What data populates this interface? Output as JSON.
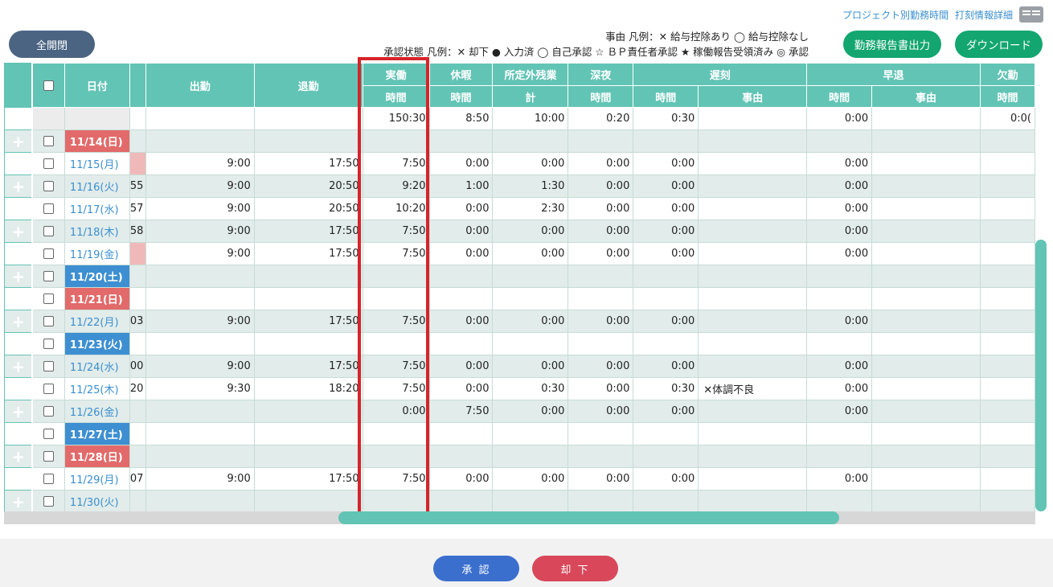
{
  "top_links": {
    "project_hours": "プロジェクト別勤務時間",
    "punch_details": "打刻情報詳細",
    "book_icon": "book-icon"
  },
  "expand_button": "全開閉",
  "legend": {
    "reason": "事由 凡例：✕ 給与控除あり ◯ 給与控除なし",
    "approval": "承認状態 凡例：✕ 却下 ● 入力済 ◯ 自己承認 ☆ ＢＰ責任者承認 ★ 稼働報告受領済み ◎ 承認"
  },
  "buttons": {
    "report_output": "勤務報告書出力",
    "download": "ダウンロード",
    "approve": "承 認",
    "reject": "却 下"
  },
  "header": {
    "date": "日付",
    "clock_in": "出勤",
    "clock_out": "退勤",
    "actual": "実働",
    "actual_sub": "時間",
    "break": "休暇",
    "break_sub": "時間",
    "overtime": "所定外残業",
    "overtime_sub": "計",
    "night": "深夜",
    "night_sub": "時間",
    "late": "遅刻",
    "late_sub_time": "時間",
    "late_sub_reason": "事由",
    "early": "早退",
    "early_sub_time": "時間",
    "early_sub_reason": "事由",
    "absence": "欠勤",
    "absence_sub": "時間"
  },
  "totals": {
    "actual": "150:30",
    "break": "8:50",
    "overtime": "10:00",
    "night": "0:20",
    "late": "0:30",
    "early": "0:00",
    "absence": "0:0("
  },
  "rows": [
    {
      "date": "11/14(日)",
      "kind": "sun",
      "stub": "",
      "in": "",
      "out": "",
      "actual": "",
      "break": "",
      "ot": "",
      "night": "",
      "late": "",
      "reason": "",
      "early": ""
    },
    {
      "date": "11/15(月)",
      "kind": "day",
      "stub": "",
      "pink": true,
      "in": "9:00",
      "out": "17:50",
      "actual": "7:50",
      "break": "0:00",
      "ot": "0:00",
      "night": "0:00",
      "late": "0:00",
      "reason": "",
      "early": "0:00"
    },
    {
      "date": "11/16(火)",
      "kind": "day",
      "stub": "55",
      "in": "9:00",
      "out": "20:50",
      "actual": "9:20",
      "break": "1:00",
      "ot": "1:30",
      "night": "0:00",
      "late": "0:00",
      "reason": "",
      "early": "0:00"
    },
    {
      "date": "11/17(水)",
      "kind": "day",
      "stub": "57",
      "in": "9:00",
      "out": "20:50",
      "actual": "10:20",
      "break": "0:00",
      "ot": "2:30",
      "night": "0:00",
      "late": "0:00",
      "reason": "",
      "early": "0:00"
    },
    {
      "date": "11/18(木)",
      "kind": "day",
      "stub": "58",
      "in": "9:00",
      "out": "17:50",
      "actual": "7:50",
      "break": "0:00",
      "ot": "0:00",
      "night": "0:00",
      "late": "0:00",
      "reason": "",
      "early": "0:00"
    },
    {
      "date": "11/19(金)",
      "kind": "day",
      "stub": "",
      "pink": true,
      "in": "9:00",
      "out": "17:50",
      "actual": "7:50",
      "break": "0:00",
      "ot": "0:00",
      "night": "0:00",
      "late": "0:00",
      "reason": "",
      "early": "0:00"
    },
    {
      "date": "11/20(土)",
      "kind": "sat",
      "stub": "",
      "in": "",
      "out": "",
      "actual": "",
      "break": "",
      "ot": "",
      "night": "",
      "late": "",
      "reason": "",
      "early": ""
    },
    {
      "date": "11/21(日)",
      "kind": "sun",
      "stub": "",
      "in": "",
      "out": "",
      "actual": "",
      "break": "",
      "ot": "",
      "night": "",
      "late": "",
      "reason": "",
      "early": ""
    },
    {
      "date": "11/22(月)",
      "kind": "day",
      "stub": "03",
      "in": "9:00",
      "out": "17:50",
      "actual": "7:50",
      "break": "0:00",
      "ot": "0:00",
      "night": "0:00",
      "late": "0:00",
      "reason": "",
      "early": "0:00"
    },
    {
      "date": "11/23(火)",
      "kind": "sat",
      "stub": "",
      "in": "",
      "out": "",
      "actual": "",
      "break": "",
      "ot": "",
      "night": "",
      "late": "",
      "reason": "",
      "early": ""
    },
    {
      "date": "11/24(水)",
      "kind": "day",
      "stub": "00",
      "in": "9:00",
      "out": "17:50",
      "actual": "7:50",
      "break": "0:00",
      "ot": "0:00",
      "night": "0:00",
      "late": "0:00",
      "reason": "",
      "early": "0:00"
    },
    {
      "date": "11/25(木)",
      "kind": "day",
      "stub": "20",
      "in": "9:30",
      "out": "18:20",
      "actual": "7:50",
      "break": "0:00",
      "ot": "0:30",
      "night": "0:00",
      "late": "0:30",
      "reason": "✕体調不良",
      "early": "0:00"
    },
    {
      "date": "11/26(金)",
      "kind": "day",
      "stub": "",
      "in": "",
      "out": "",
      "actual": "0:00",
      "break": "7:50",
      "ot": "0:00",
      "night": "0:00",
      "late": "0:00",
      "reason": "",
      "early": "0:00"
    },
    {
      "date": "11/27(土)",
      "kind": "sat",
      "stub": "",
      "in": "",
      "out": "",
      "actual": "",
      "break": "",
      "ot": "",
      "night": "",
      "late": "",
      "reason": "",
      "early": ""
    },
    {
      "date": "11/28(日)",
      "kind": "sun",
      "stub": "",
      "in": "",
      "out": "",
      "actual": "",
      "break": "",
      "ot": "",
      "night": "",
      "late": "",
      "reason": "",
      "early": ""
    },
    {
      "date": "11/29(月)",
      "kind": "day",
      "stub": "07",
      "in": "9:00",
      "out": "17:50",
      "actual": "7:50",
      "break": "0:00",
      "ot": "0:00",
      "night": "0:00",
      "late": "0:00",
      "reason": "",
      "early": "0:00"
    },
    {
      "date": "11/30(火)",
      "kind": "day",
      "stub": "",
      "in": "",
      "out": "",
      "actual": "",
      "break": "",
      "ot": "",
      "night": "",
      "late": "",
      "reason": "",
      "early": ""
    }
  ],
  "plus_icon": "+"
}
